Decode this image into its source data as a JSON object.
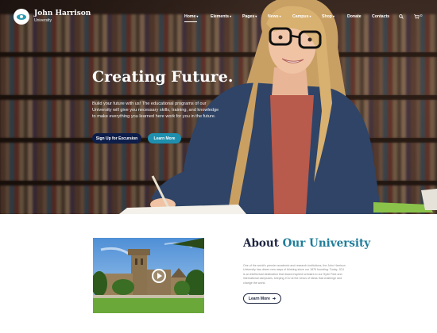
{
  "brand": {
    "name": "John Harrison",
    "subtitle": "University",
    "logo_icon": "eye-logo-icon"
  },
  "nav": {
    "items": [
      {
        "label": "Home",
        "has_caret": true
      },
      {
        "label": "Elements",
        "has_caret": true
      },
      {
        "label": "Pages",
        "has_caret": true
      },
      {
        "label": "News",
        "has_caret": true
      },
      {
        "label": "Campus",
        "has_caret": true
      },
      {
        "label": "Shop",
        "has_caret": true
      },
      {
        "label": "Donate",
        "has_caret": false
      },
      {
        "label": "Contacts",
        "has_caret": false
      }
    ],
    "cart_count": "0",
    "search_icon": "search-icon",
    "cart_icon": "cart-icon"
  },
  "hero": {
    "title": "Creating Future.",
    "description": "Build your future with us! The educational programs of our University will give you necessary skills, training, and knowledge to make everything you learned here work for you in the future.",
    "primary_button": "Sign Up for Excursion",
    "secondary_button": "Learn More"
  },
  "about": {
    "title_prefix": "About ",
    "title_accent": "Our University",
    "text": "One of the world's premier academic and research institutions, the John Harrison University has driven new ways of thinking since our 1876 founding. Today, JCU is an intellectual destination that draws inspired scholars to our Hyde Park and international campuses, keeping JCU at the nexus of ideas that challenge and change the world.",
    "button": "Learn More",
    "play_icon": "play-icon"
  },
  "colors": {
    "accent": "#1f7d9a",
    "navy": "#0e1e4a",
    "teal_button": "#1e8fae",
    "heading": "#1d2540"
  }
}
